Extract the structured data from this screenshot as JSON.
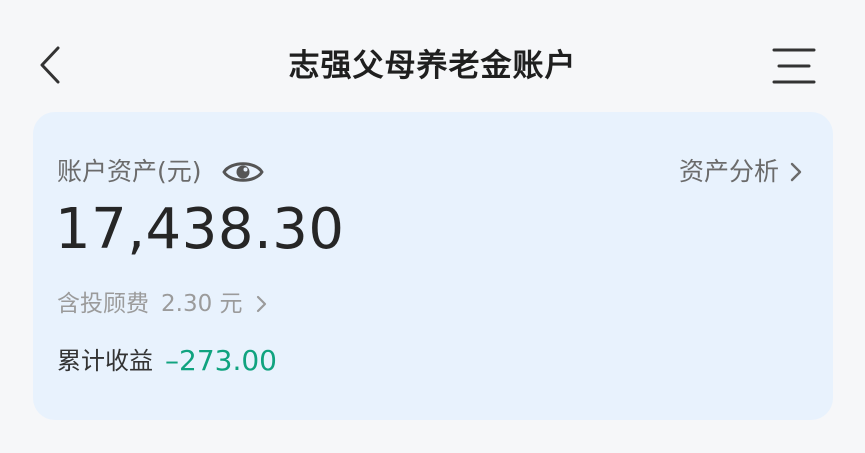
{
  "header": {
    "title": "志强父母养老金账户",
    "back_icon": "chevron-left-icon",
    "menu_icon": "hamburger-menu-icon"
  },
  "account": {
    "asset_label": "账户资产(元)",
    "eye_icon": "eye-icon",
    "analysis_label": "资产分析",
    "total_assets": "17,438.30",
    "fee_label": "含投顾费",
    "fee_value": "2.30 元",
    "profit_label": "累计收益",
    "profit_value": "–273.00"
  },
  "colors": {
    "card_bg": "#e8f2fd",
    "page_bg": "#f6f7f9",
    "profit_color": "#10a37f",
    "muted_text": "#9b9b9b"
  }
}
